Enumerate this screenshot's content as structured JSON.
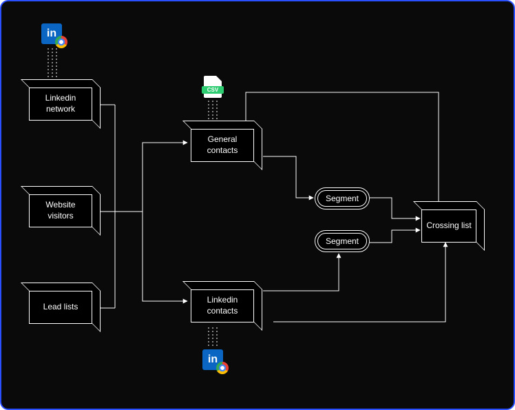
{
  "nodes": {
    "linkedin_network": {
      "label": "Linkedin\nnetwork"
    },
    "website_visitors": {
      "label": "Website\nvisitors"
    },
    "lead_lists": {
      "label": "Lead\nlists"
    },
    "general_contacts": {
      "label": "General\ncontacts"
    },
    "linkedin_contacts": {
      "label": "Linkedin\ncontacts"
    },
    "crossing_list": {
      "label": "Crossing\nlist"
    },
    "segment_top": {
      "label": "Segment"
    },
    "segment_bottom": {
      "label": "Segment"
    }
  },
  "icons": {
    "linkedin_top": {
      "type": "linkedin+chrome"
    },
    "linkedin_bottom": {
      "type": "linkedin+chrome"
    },
    "csv": {
      "type": "csv",
      "text": "CSV"
    }
  },
  "colors": {
    "background": "#0a0a0a",
    "border": "#2a4fff",
    "line": "#ffffff",
    "linkedin": "#0a66c2",
    "csv": "#2ecc71"
  }
}
